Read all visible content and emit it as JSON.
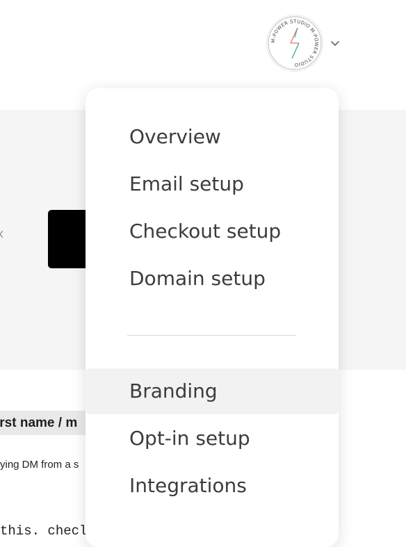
{
  "header": {
    "avatar": {
      "icon": "lightning-bolt-icon",
      "ring_text": "M-POWER STUDIO M-POWER STUDIO"
    },
    "chevron": "chevron-down-icon"
  },
  "background": {
    "table_header_text": "irst name / m",
    "body_text": "ying DM from a s",
    "code_text": "this. checl"
  },
  "dropdown": {
    "items": [
      {
        "label": "Overview"
      },
      {
        "label": "Email setup"
      },
      {
        "label": "Checkout setup"
      },
      {
        "label": "Domain setup"
      },
      {
        "label": "Branding",
        "active": true
      },
      {
        "label": "Opt-in setup"
      },
      {
        "label": "Integrations"
      }
    ]
  },
  "colors": {
    "active_item_bg": "#f2f2f2",
    "text": "#3c3c3c",
    "bolt_left": "#e0786e",
    "bolt_right": "#3aa79b"
  }
}
